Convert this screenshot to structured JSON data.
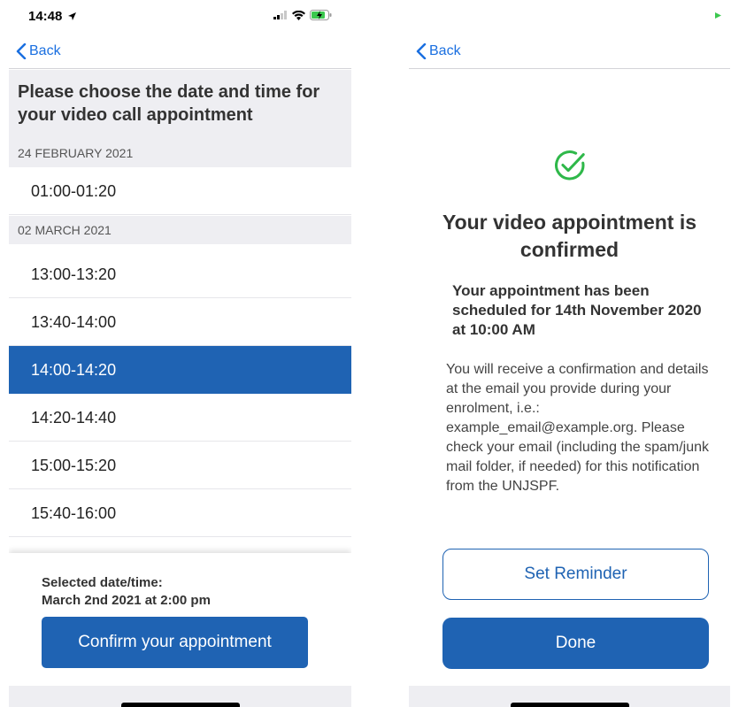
{
  "left_screen": {
    "status_bar": {
      "time": "14:48"
    },
    "nav": {
      "back_label": "Back"
    },
    "title": "Please choose the date and time for your video call appointment",
    "sections": [
      {
        "date": "24 FEBRUARY 2021",
        "slots": [
          "01:00-01:20"
        ]
      },
      {
        "date": "02 MARCH 2021",
        "slots": [
          "13:00-13:20",
          "13:40-14:00",
          "14:00-14:20",
          "14:20-14:40",
          "15:00-15:20",
          "15:40-16:00"
        ]
      }
    ],
    "selected_slot": "14:00-14:20",
    "selected_label": "Selected date/time:",
    "selected_value": "March 2nd 2021 at 2:00 pm",
    "confirm_label": "Confirm your appointment"
  },
  "right_screen": {
    "nav": {
      "back_label": "Back"
    },
    "confirm_title": "Your video appointment is confirmed",
    "schedule_text": "Your appointment has been scheduled for 14th November 2020 at 10:00 AM",
    "info_text": "You will receive a confirmation and details at the email you provide during your enrolment, i.e.: example_email@example.org. Please check your email (including the spam/junk mail folder, if needed) for this notification from the UNJSPF.",
    "reminder_label": "Set Reminder",
    "done_label": "Done"
  },
  "colors": {
    "accent": "#1f63b3",
    "link": "#1a6fe0",
    "success": "#2fb84a",
    "header_bg": "#eeeef2"
  },
  "icons": [
    "location-arrow-icon",
    "signal-icon",
    "wifi-icon",
    "battery-charging-icon",
    "chevron-left-icon",
    "check-circle-icon"
  ]
}
